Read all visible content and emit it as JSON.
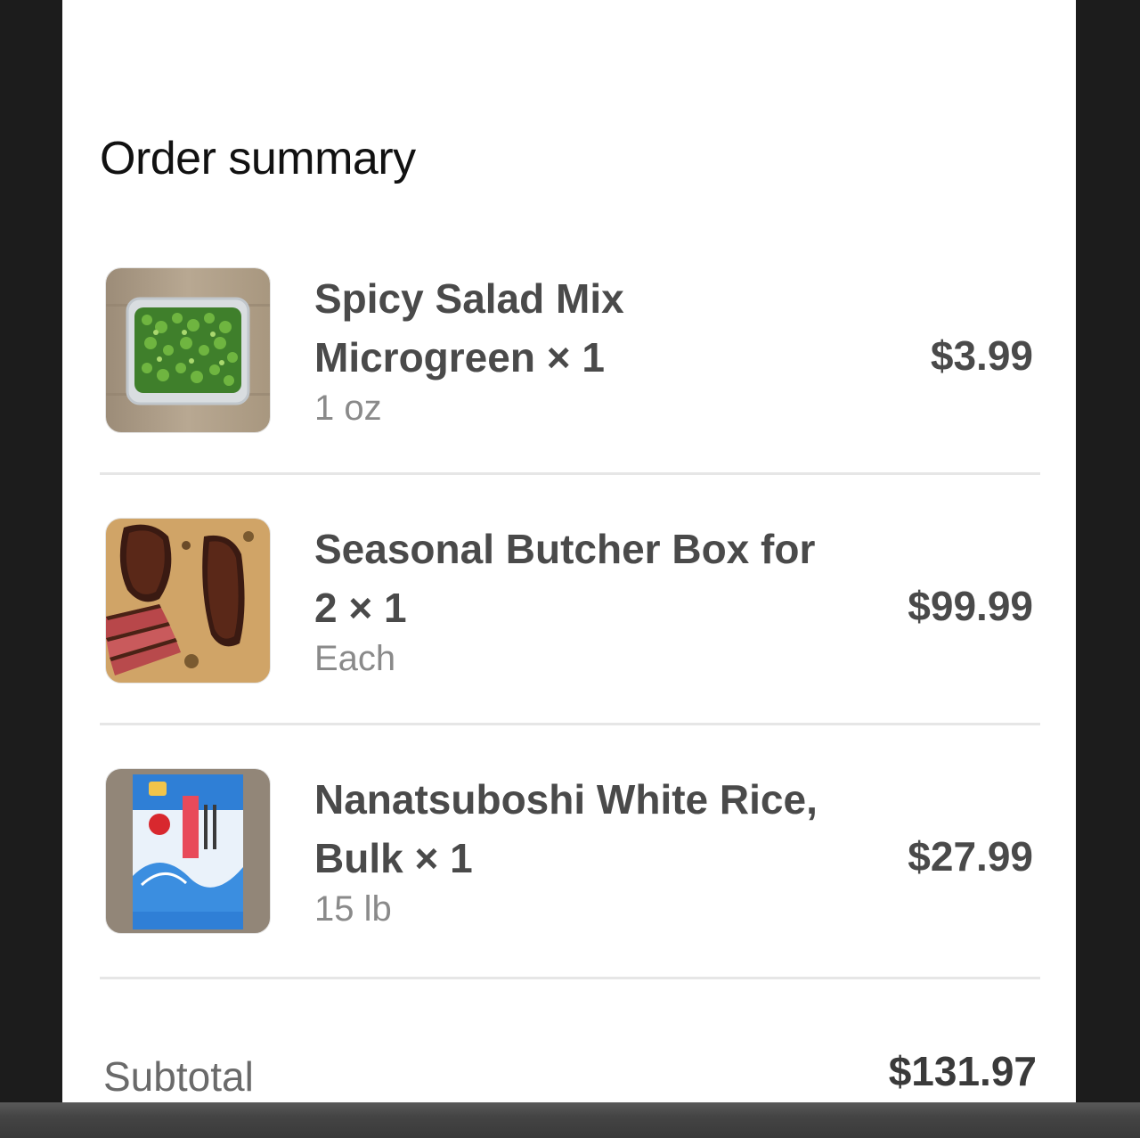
{
  "order_summary": {
    "title": "Order summary",
    "items": [
      {
        "name_line1": "Spicy Salad Mix",
        "name_line2": "Microgreen × 1",
        "unit": "1 oz",
        "price": "$3.99",
        "image_icon": "microgreens-container-image"
      },
      {
        "name_line1": "Seasonal Butcher Box for",
        "name_line2": "2 × 1",
        "unit": "Each",
        "price": "$99.99",
        "image_icon": "steak-cuts-image"
      },
      {
        "name_line1": "Nanatsuboshi White Rice,",
        "name_line2": "Bulk × 1",
        "unit": "15 lb",
        "price": "$27.99",
        "image_icon": "rice-bag-image"
      }
    ],
    "subtotal_label": "Subtotal",
    "subtotal_value": "$131.97"
  },
  "colors": {
    "background": "#ffffff",
    "frame": "#1c1c1c",
    "text_primary": "#4a4a4a",
    "text_secondary": "#8a8a8a",
    "divider": "#e6e6e6"
  }
}
